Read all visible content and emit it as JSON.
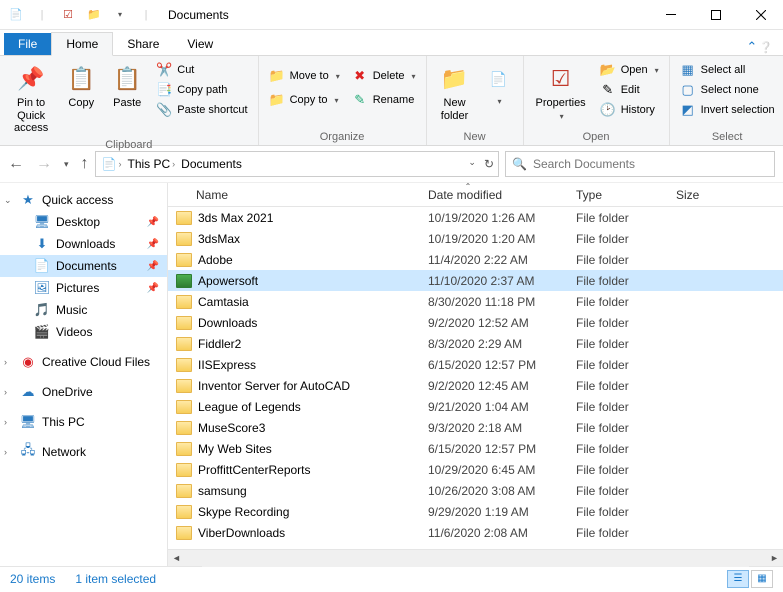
{
  "window": {
    "title": "Documents"
  },
  "tabs": {
    "file": "File",
    "home": "Home",
    "share": "Share",
    "view": "View"
  },
  "ribbon": {
    "clipboard": {
      "label": "Clipboard",
      "pin": "Pin to Quick\naccess",
      "copy": "Copy",
      "paste": "Paste",
      "cut": "Cut",
      "copy_path": "Copy path",
      "paste_shortcut": "Paste shortcut"
    },
    "organize": {
      "label": "Organize",
      "move_to": "Move to",
      "copy_to": "Copy to",
      "delete": "Delete",
      "rename": "Rename"
    },
    "new": {
      "label": "New",
      "new_folder": "New\nfolder"
    },
    "open": {
      "label": "Open",
      "properties": "Properties",
      "open": "Open",
      "edit": "Edit",
      "history": "History"
    },
    "select": {
      "label": "Select",
      "select_all": "Select all",
      "select_none": "Select none",
      "invert": "Invert selection"
    }
  },
  "breadcrumb": {
    "root": "This PC",
    "current": "Documents"
  },
  "search": {
    "placeholder": "Search Documents"
  },
  "sidebar": {
    "quick_access": "Quick access",
    "desktop": "Desktop",
    "downloads": "Downloads",
    "documents": "Documents",
    "pictures": "Pictures",
    "music": "Music",
    "videos": "Videos",
    "creative": "Creative Cloud Files",
    "onedrive": "OneDrive",
    "this_pc": "This PC",
    "network": "Network"
  },
  "columns": {
    "name": "Name",
    "date": "Date modified",
    "type": "Type",
    "size": "Size"
  },
  "items": [
    {
      "name": "3ds Max 2021",
      "date": "10/19/2020 1:26 AM",
      "type": "File folder"
    },
    {
      "name": "3dsMax",
      "date": "10/19/2020 1:20 AM",
      "type": "File folder"
    },
    {
      "name": "Adobe",
      "date": "11/4/2020 2:22 AM",
      "type": "File folder"
    },
    {
      "name": "Apowersoft",
      "date": "11/10/2020 2:37 AM",
      "type": "File folder",
      "selected": true,
      "green": true
    },
    {
      "name": "Camtasia",
      "date": "8/30/2020 11:18 PM",
      "type": "File folder"
    },
    {
      "name": "Downloads",
      "date": "9/2/2020 12:52 AM",
      "type": "File folder"
    },
    {
      "name": "Fiddler2",
      "date": "8/3/2020 2:29 AM",
      "type": "File folder"
    },
    {
      "name": "IISExpress",
      "date": "6/15/2020 12:57 PM",
      "type": "File folder"
    },
    {
      "name": "Inventor Server for AutoCAD",
      "date": "9/2/2020 12:45 AM",
      "type": "File folder"
    },
    {
      "name": "League of Legends",
      "date": "9/21/2020 1:04 AM",
      "type": "File folder"
    },
    {
      "name": "MuseScore3",
      "date": "9/3/2020 2:18 AM",
      "type": "File folder"
    },
    {
      "name": "My Web Sites",
      "date": "6/15/2020 12:57 PM",
      "type": "File folder"
    },
    {
      "name": "ProffittCenterReports",
      "date": "10/29/2020 6:45 AM",
      "type": "File folder"
    },
    {
      "name": "samsung",
      "date": "10/26/2020 3:08 AM",
      "type": "File folder"
    },
    {
      "name": "Skype Recording",
      "date": "9/29/2020 1:19 AM",
      "type": "File folder"
    },
    {
      "name": "ViberDownloads",
      "date": "11/6/2020 2:08 AM",
      "type": "File folder"
    }
  ],
  "status": {
    "count": "20 items",
    "selection": "1 item selected"
  }
}
